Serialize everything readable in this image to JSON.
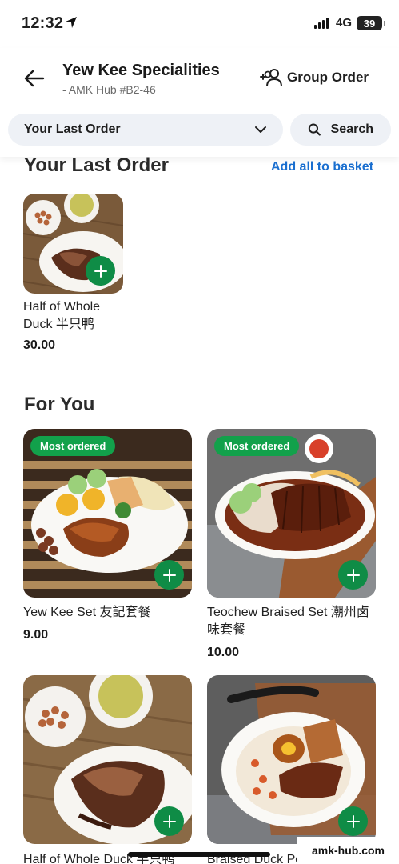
{
  "status_bar": {
    "time": "12:32",
    "network": "4G",
    "battery": "39"
  },
  "header": {
    "store_name": "Yew Kee Specialities",
    "store_location": "- AMK Hub #B2-46",
    "group_order_label": "Group Order",
    "menu_selector_label": "Your Last Order",
    "search_label": "Search"
  },
  "last_order": {
    "title": "Your Last Order",
    "add_all_label": "Add all to basket",
    "items": [
      {
        "name_line1": "Half of Whole",
        "name_line2": "Duck 半只鸭",
        "price": "30.00"
      }
    ]
  },
  "for_you": {
    "title": "For You",
    "items": [
      {
        "badge": "Most ordered",
        "name_line1": "Yew Kee Set 友記套餐",
        "name_line2": "",
        "price": "9.00"
      },
      {
        "badge": "Most ordered",
        "name_line1": "Teochew Braised Set 潮州卤",
        "name_line2": "味套餐",
        "price": "10.00"
      },
      {
        "badge": "",
        "name_line1": "Half of Whole Duck 半只鸭",
        "name_line2": "",
        "price": ""
      },
      {
        "badge": "",
        "name_line1": "Braised Duck Porridge 卤",
        "name_line2": "",
        "price": ""
      }
    ]
  },
  "watermark": "amk-hub.com",
  "colors": {
    "accent_green": "#0f8c46",
    "badge_green": "#12a14b",
    "link_blue": "#1a6fd0",
    "pill_bg": "#eef1f6"
  }
}
